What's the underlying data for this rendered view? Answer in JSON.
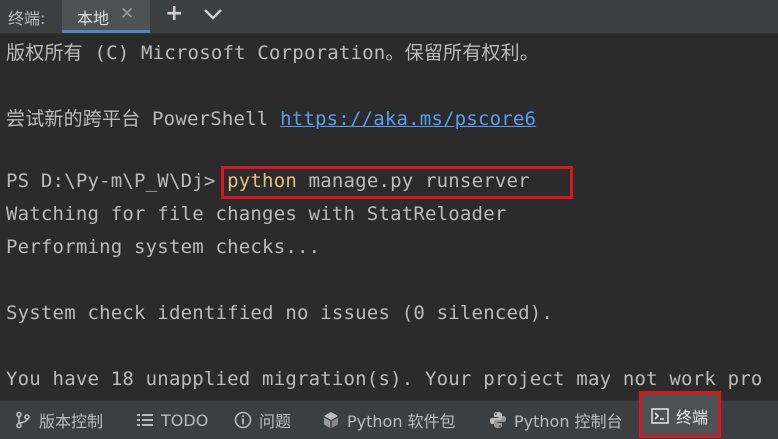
{
  "topbar": {
    "label": "终端:",
    "tab_label": "本地",
    "tab_close": "✕",
    "new_tab": "+",
    "dropdown_icon": "chevron-down-icon"
  },
  "terminal": {
    "line1": "版权所有 (C) Microsoft Corporation。保留所有权利。",
    "line2_prefix": "尝试新的跨平台 PowerShell ",
    "line2_link": "https://aka.ms/pscore6",
    "prompt": "PS D:\\Py-m\\P_W\\Dj> ",
    "cmd_keyword": "python",
    "cmd_rest": " manage.py runserver",
    "line4": "Watching for file changes with StatReloader",
    "line5": "Performing system checks...",
    "line6": "System check identified no issues (0 silenced).",
    "line7": "You have 18 unapplied migration(s). Your project may not work pro"
  },
  "bottombar": {
    "items": [
      {
        "label": "版本控制",
        "icon": "branch-icon"
      },
      {
        "label": "TODO",
        "icon": "list-icon"
      },
      {
        "label": "问题",
        "icon": "info-icon"
      },
      {
        "label": "Python 软件包",
        "icon": "packages-icon"
      },
      {
        "label": "Python 控制台",
        "icon": "python-icon"
      },
      {
        "label": "终端",
        "icon": "terminal-icon"
      }
    ]
  },
  "colors": {
    "background": "#2b2b2b",
    "bar": "#3c3f41",
    "link": "#589df6",
    "keyword": "#e5c07b",
    "highlight": "#d8161f"
  }
}
